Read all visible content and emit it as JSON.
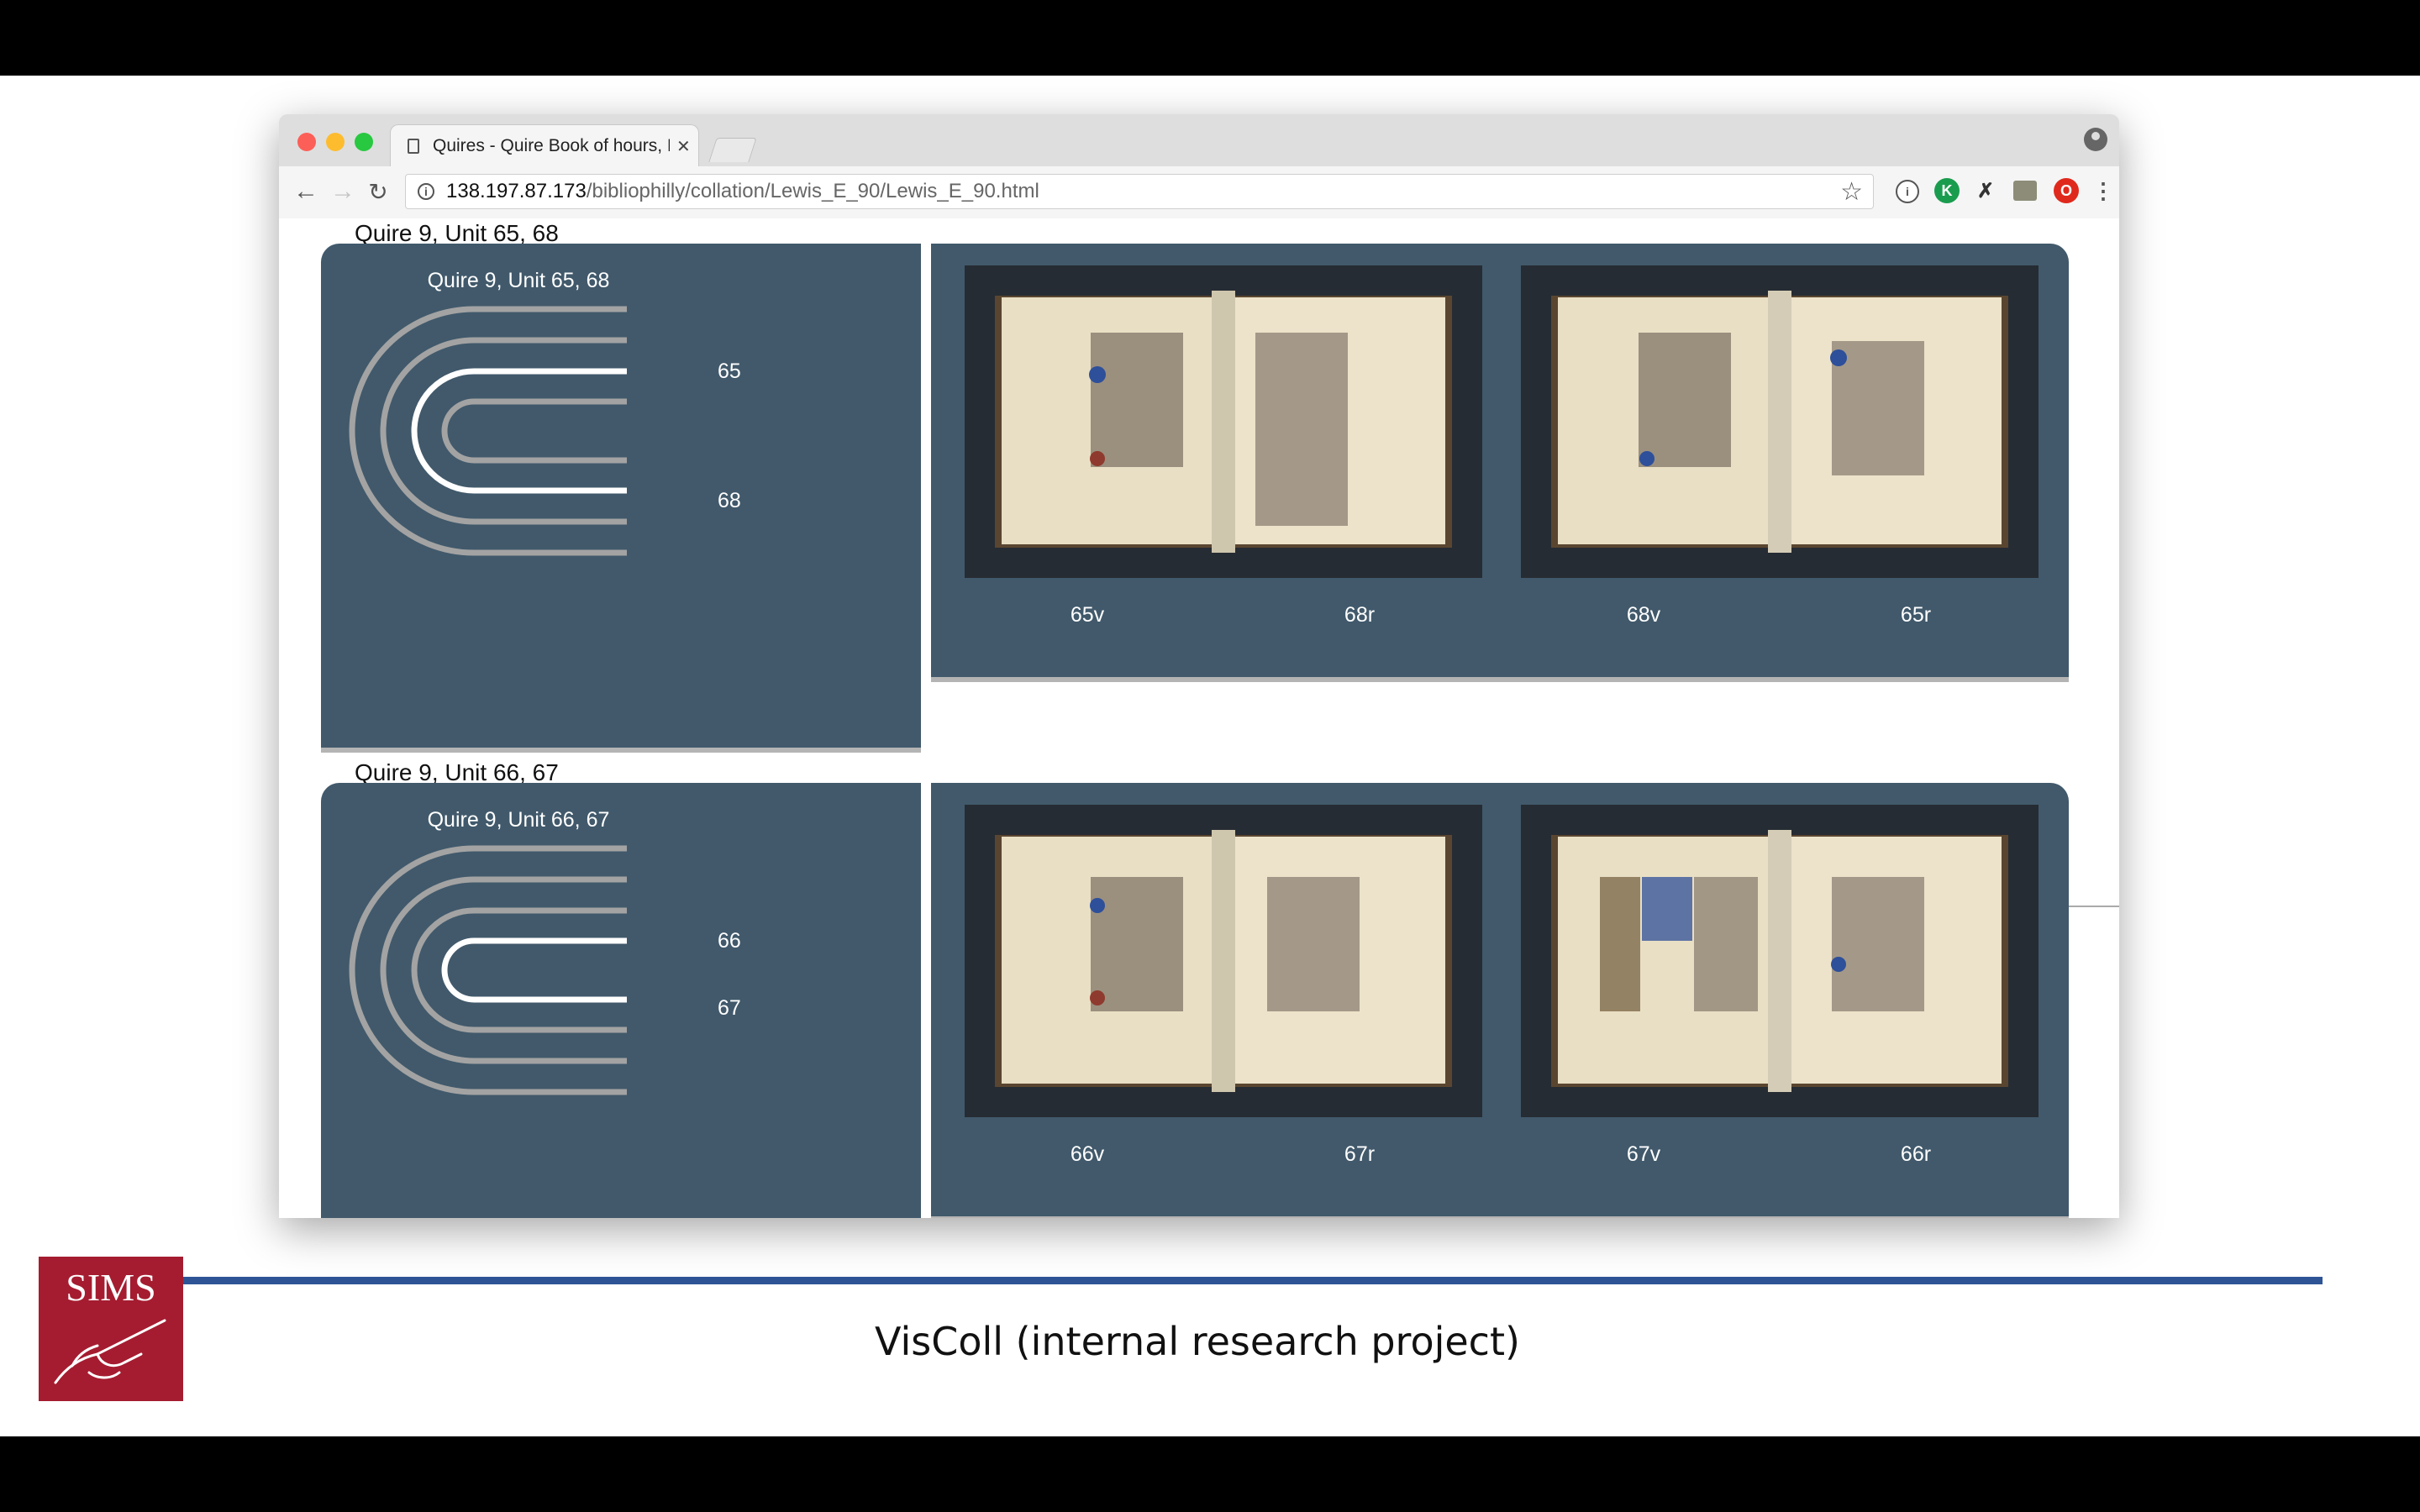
{
  "browser": {
    "tab_title": "Quires - Quire Book of hours, L",
    "url_host": "138.197.87.173",
    "url_path": "/bibliophilly/collation/Lewis_E_90/Lewis_E_90.html"
  },
  "units": [
    {
      "caption": "Quire 9, Unit 65, 68",
      "diagram_title": "Quire 9, Unit 65, 68",
      "leaves": [
        "65",
        "68"
      ],
      "folios": [
        "65v",
        "68r",
        "68v",
        "65r"
      ]
    },
    {
      "caption": "Quire 9, Unit 66, 67",
      "diagram_title": "Quire 9, Unit 66, 67",
      "leaves": [
        "66",
        "67"
      ],
      "folios": [
        "66v",
        "67r",
        "67v",
        "66r"
      ]
    }
  ],
  "colors": {
    "panel": "#41596b",
    "leaf_normal": "#a3a3a3",
    "leaf_highlight": "#ffffff",
    "logo_red": "#a51c30",
    "rule_blue": "#2f5496"
  },
  "slide": {
    "logo_text": "SIMS",
    "caption": "VisColl (internal research project)"
  }
}
